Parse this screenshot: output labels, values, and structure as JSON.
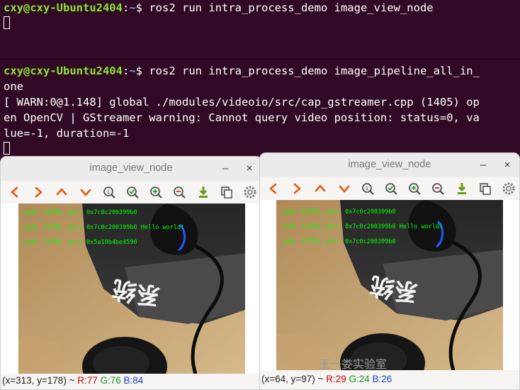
{
  "terminal1": {
    "prompt_user": "cxy@cxy-Ubuntu2404",
    "prompt_sep": ":",
    "prompt_path": "~",
    "prompt_sym": "$ ",
    "command": "ros2 run intra_process_demo image_view_node"
  },
  "terminal2": {
    "prompt_user": "cxy@cxy-Ubuntu2404",
    "prompt_sep": ":",
    "prompt_path": "~",
    "prompt_sym": "$ ",
    "command_l1": "ros2 run intra_process_demo image_pipeline_all_in_",
    "command_l2": "one",
    "out1": "[ WARN:0@1.148] global ./modules/videoio/src/cap_gstreamer.cpp (1405) op",
    "out2": "en OpenCV | GStreamer warning: Cannot query video position: status=0, va",
    "out3": "lue=-1, duration=-1"
  },
  "viewer1": {
    "title": "image_view_node",
    "overlay": [
      "pid: 13755, ptr: 0x7c0c200399b0",
      "pid: 13755, ptr: 0x7c0c200399b0 Hello world!",
      "pid: 13793, ptr: 0x5a10b4be4590"
    ],
    "status": {
      "coords": "(x=313, y=178) ~ ",
      "r": "R:77",
      "g": "G:76",
      "b": "B:84"
    }
  },
  "viewer2": {
    "title": "image_view_node",
    "overlay": [
      "pid: 13755, ptr: 0x7c0c200399b0",
      "pid: 13755, ptr: 0x7c0c200399b0 Hello world!",
      "pid: 13755, ptr: 0x7c0c200399b0"
    ],
    "status": {
      "coords": "(x=64, y=97) ~ ",
      "r": "R:29",
      "g": "G:24",
      "b": "B:26"
    }
  },
  "window_controls": {
    "minimize": "–",
    "close": "×"
  },
  "toolbar_icons": [
    "arrow-left-icon",
    "arrow-right-icon",
    "arrow-up-icon",
    "arrow-down-icon",
    "zoom-reset-icon",
    "zoom-fit-icon",
    "zoom-in-icon",
    "zoom-out-icon",
    "save-icon",
    "copy-icon",
    "settings-icon"
  ],
  "watermark": "王一娄实验室",
  "colors": {
    "terminal_bg": "#300a24",
    "prompt_user": "#8ae234",
    "prompt_path": "#729fcf",
    "overlay_text": "#00ff00"
  }
}
